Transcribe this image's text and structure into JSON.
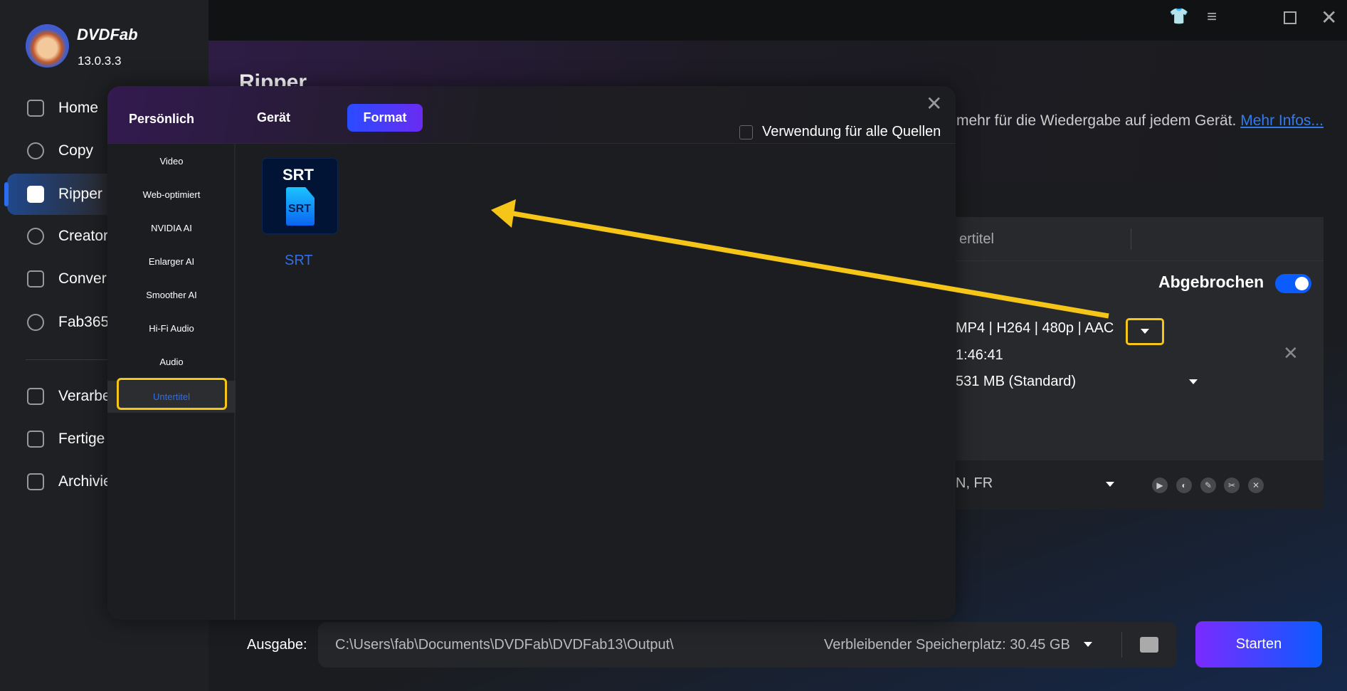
{
  "app": {
    "name": "DVDFab",
    "version": "13.0.3.3"
  },
  "sidebar": {
    "items": [
      {
        "label": "Home",
        "icon": "home-icon"
      },
      {
        "label": "Copy",
        "icon": "copy-icon"
      },
      {
        "label": "Ripper",
        "icon": "ripper-icon",
        "active": true
      },
      {
        "label": "Creator",
        "icon": "creator-icon"
      },
      {
        "label": "Conver",
        "icon": "converter-icon"
      },
      {
        "label": "Fab365",
        "icon": "fab365-icon"
      }
    ],
    "items2": [
      {
        "label": "Verarbe",
        "icon": "queue-icon"
      },
      {
        "label": "Fertige",
        "icon": "finished-icon"
      },
      {
        "label": "Archivie",
        "icon": "archive-icon"
      }
    ]
  },
  "header": {
    "title": "Ripper",
    "description": "mehr für die Wiedergabe auf jedem Gerät.",
    "link": "Mehr Infos..."
  },
  "dialog": {
    "tabs": [
      "Persönlich",
      "Gerät",
      "Format"
    ],
    "active_tab": "Format",
    "apply_all": "Verwendung für alle Quellen",
    "apply_all_checked": false,
    "categories": [
      "Video",
      "Web-optimiert",
      "NVIDIA AI",
      "Enlarger AI",
      "Smoother AI",
      "Hi-Fi Audio",
      "Audio",
      "Untertitel"
    ],
    "selected_category": "Untertitel",
    "formats": [
      {
        "label": "SRT",
        "tile_top": "SRT",
        "tile_doc": "SRT"
      }
    ]
  },
  "panel": {
    "tab_partial": "ertitel",
    "status": "Abgebrochen",
    "toggle_on": true,
    "profile": "MP4 | H264 | 480p | AAC",
    "duration": "1:46:41",
    "size": "531 MB (Standard)",
    "subs": "N, FR"
  },
  "footer": {
    "output_label": "Ausgabe:",
    "path": "C:\\Users\\fab\\Documents\\DVDFab\\DVDFab13\\Output\\",
    "space": "Verbleibender Speicherplatz: 30.45 GB",
    "start": "Starten"
  },
  "colors": {
    "accent": "#2b6cf0",
    "highlight": "#f5c518",
    "start_from": "#7b2bff",
    "start_to": "#0a5cff"
  }
}
